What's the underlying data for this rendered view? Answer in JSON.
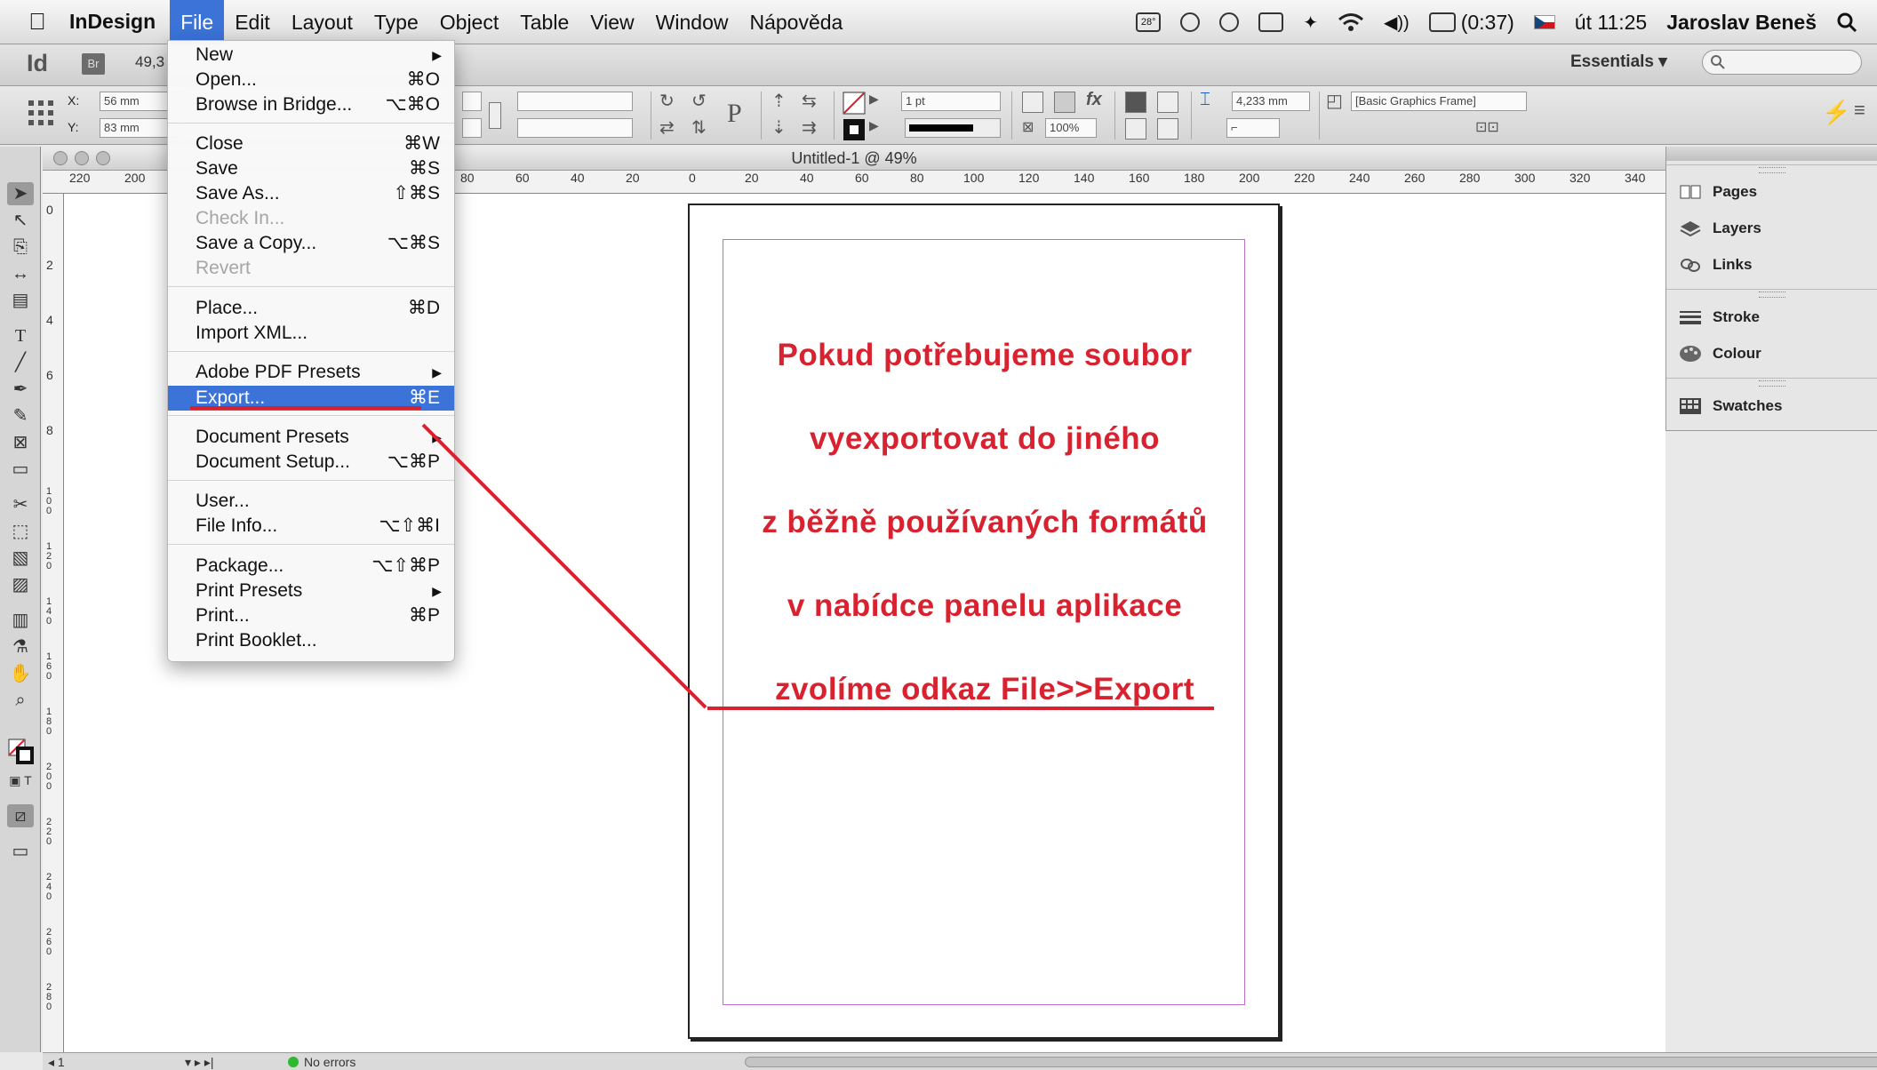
{
  "menubar": {
    "apple": "",
    "app": "InDesign",
    "items": [
      "File",
      "Edit",
      "Layout",
      "Type",
      "Object",
      "Table",
      "View",
      "Window",
      "Nápověda"
    ],
    "temperature": "28°",
    "battery": "(0:37)",
    "clock": "út 11:25",
    "user": "Jaroslav Beneš"
  },
  "appbar": {
    "logo": "Id",
    "bridge": "Br",
    "zoom": "49,3",
    "workspace": "Essentials ▾"
  },
  "control": {
    "x_label": "X:",
    "x_value": "56 mm",
    "y_label": "Y:",
    "y_value": "83 mm",
    "stroke_weight": "1 pt",
    "opacity": "100%",
    "dimension": "4,233 mm",
    "object_style": "[Basic Graphics Frame]"
  },
  "document": {
    "title": "Untitled-1 @ 49%"
  },
  "ruler": {
    "h": [
      "220",
      "200",
      "80",
      "60",
      "40",
      "20",
      "0",
      "20",
      "40",
      "60",
      "80",
      "100",
      "120",
      "140",
      "160",
      "180",
      "200",
      "220",
      "240",
      "260",
      "280",
      "300",
      "320",
      "340"
    ],
    "v": [
      "0",
      "2",
      "4",
      "6",
      "8",
      "100",
      "120",
      "140",
      "160",
      "180",
      "200",
      "220",
      "240",
      "260",
      "280"
    ]
  },
  "page_text": [
    "Pokud potřebujeme soubor",
    "vyexportovat do jiného",
    "z běžně používaných formátů",
    "v nabídce panelu aplikace",
    "zvolíme odkaz File>>Export"
  ],
  "file_menu": {
    "items": [
      {
        "label": "New",
        "shortcut": "",
        "submenu": true
      },
      {
        "label": "Open...",
        "shortcut": "⌘O"
      },
      {
        "label": "Browse in Bridge...",
        "shortcut": "⌥⌘O"
      },
      {
        "label": "Close",
        "shortcut": "⌘W"
      },
      {
        "label": "Save",
        "shortcut": "⌘S"
      },
      {
        "label": "Save As...",
        "shortcut": "⇧⌘S"
      },
      {
        "label": "Check In...",
        "shortcut": "",
        "disabled": true
      },
      {
        "label": "Save a Copy...",
        "shortcut": "⌥⌘S"
      },
      {
        "label": "Revert",
        "shortcut": "",
        "disabled": true
      },
      {
        "label": "Place...",
        "shortcut": "⌘D"
      },
      {
        "label": "Import XML...",
        "shortcut": ""
      },
      {
        "label": "Adobe PDF Presets",
        "shortcut": "",
        "submenu": true
      },
      {
        "label": "Export...",
        "shortcut": "⌘E",
        "highlighted": true
      },
      {
        "label": "Document Presets",
        "shortcut": "",
        "submenu": true
      },
      {
        "label": "Document Setup...",
        "shortcut": "⌥⌘P"
      },
      {
        "label": "User...",
        "shortcut": ""
      },
      {
        "label": "File Info...",
        "shortcut": "⌥⇧⌘I"
      },
      {
        "label": "Package...",
        "shortcut": "⌥⇧⌘P"
      },
      {
        "label": "Print Presets",
        "shortcut": "",
        "submenu": true
      },
      {
        "label": "Print...",
        "shortcut": "⌘P"
      },
      {
        "label": "Print Booklet...",
        "shortcut": ""
      }
    ]
  },
  "panels": [
    "Pages",
    "Layers",
    "Links",
    "Stroke",
    "Colour",
    "Swatches"
  ],
  "status": {
    "page": "1",
    "preflight": "No errors"
  },
  "colors": {
    "annotation": "#d8222f",
    "menu_highlight": "#3b73d9",
    "margin_guide": "#c46ad3"
  }
}
